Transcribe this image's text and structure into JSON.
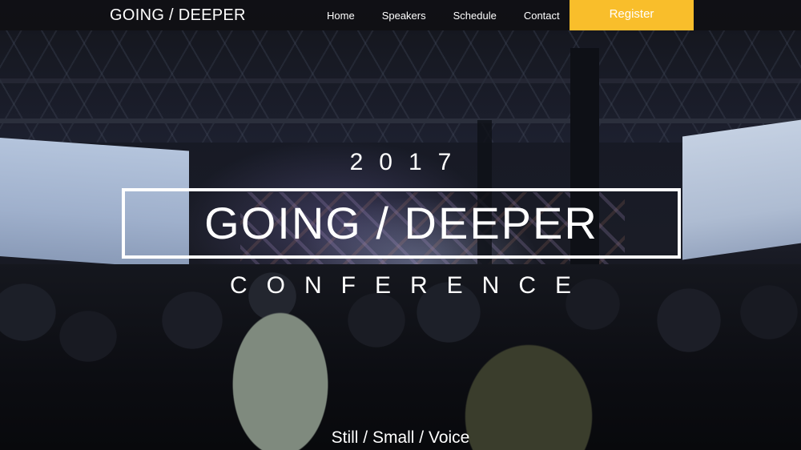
{
  "header": {
    "brand": "GOING / DEEPER",
    "nav": [
      {
        "label": "Home"
      },
      {
        "label": "Speakers"
      },
      {
        "label": "Schedule"
      },
      {
        "label": "Contact"
      }
    ],
    "register_label": "Register"
  },
  "hero": {
    "year": "2017",
    "title": "GOING / DEEPER",
    "subtitle": "CONFERENCE",
    "tagline": "Still / Small / Voice",
    "background": "concert-crowd-photo"
  },
  "colors": {
    "accent": "#f9be2b",
    "nav_bg": "#0f0f12",
    "text": "#ffffff"
  }
}
